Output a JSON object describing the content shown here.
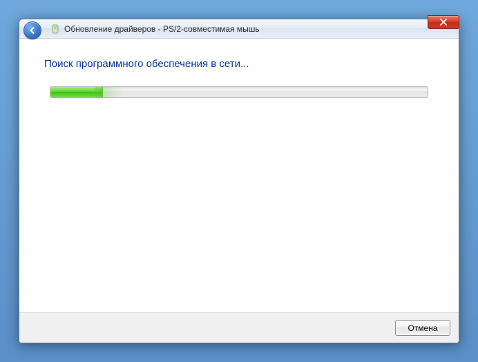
{
  "titlebar": {
    "title": "Обновление драйверов - PS/2-совместимая мышь"
  },
  "content": {
    "heading": "Поиск программного обеспечения в сети...",
    "progress_percent": 14
  },
  "footer": {
    "cancel_label": "Отмена"
  }
}
